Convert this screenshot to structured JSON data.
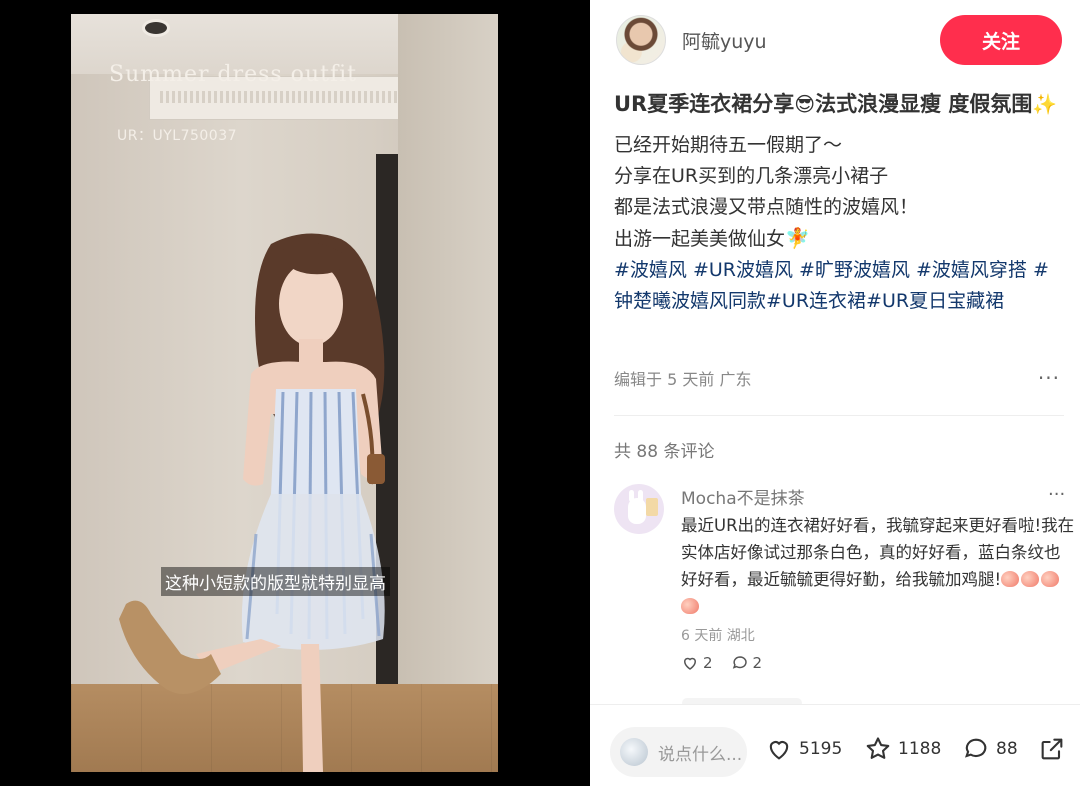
{
  "video": {
    "overlay_title": "Summer dress outfit",
    "overlay_code": "UR：UYL750037",
    "subtitle": "这种小短款的版型就特别显高"
  },
  "author": {
    "name": "阿毓yuyu",
    "follow_label": "关注"
  },
  "post": {
    "title_part1": "UR夏季连衣裙分享",
    "title_emoji1": "😎",
    "title_part2": "法式浪漫显瘦 度假氛围",
    "title_emoji2": "✨",
    "lines": [
      "已经开始期待五一假期了～",
      "分享在UR买到的几条漂亮小裙子",
      "都是法式浪漫又带点随性的波嬉风！",
      "出游一起美美做仙女"
    ],
    "line4_emoji": "🧚",
    "tags": [
      "#波嬉风",
      "#UR波嬉风",
      "#旷野波嬉风",
      "#波嬉风穿搭",
      "#钟楚曦波嬉风同款",
      "#UR连衣裙",
      "#UR夏日宝藏裙"
    ],
    "meta": "编辑于 5 天前 广东",
    "more": "···"
  },
  "comments": {
    "count_text": "共 88 条评论",
    "items": [
      {
        "name": "Mocha不是抹茶",
        "text": "最近UR出的连衣裙好好看，我毓穿起来更好看啦!我在实体店好像试过那条白色，真的好好看，蓝白条纹也好好看，最近毓毓更得好勤，给我毓加鸡腿!",
        "meta": "6 天前 湖北",
        "likes": "2",
        "replies": "2",
        "more": "···"
      }
    ]
  },
  "bottom": {
    "input_placeholder": "说点什么...",
    "likes": "5195",
    "collects": "1188",
    "comments": "88"
  },
  "colors": {
    "accent": "#ff2e4d",
    "tag": "#13386c"
  },
  "icons": [
    "heart-icon",
    "star-icon",
    "comment-bubble-icon",
    "share-icon"
  ]
}
